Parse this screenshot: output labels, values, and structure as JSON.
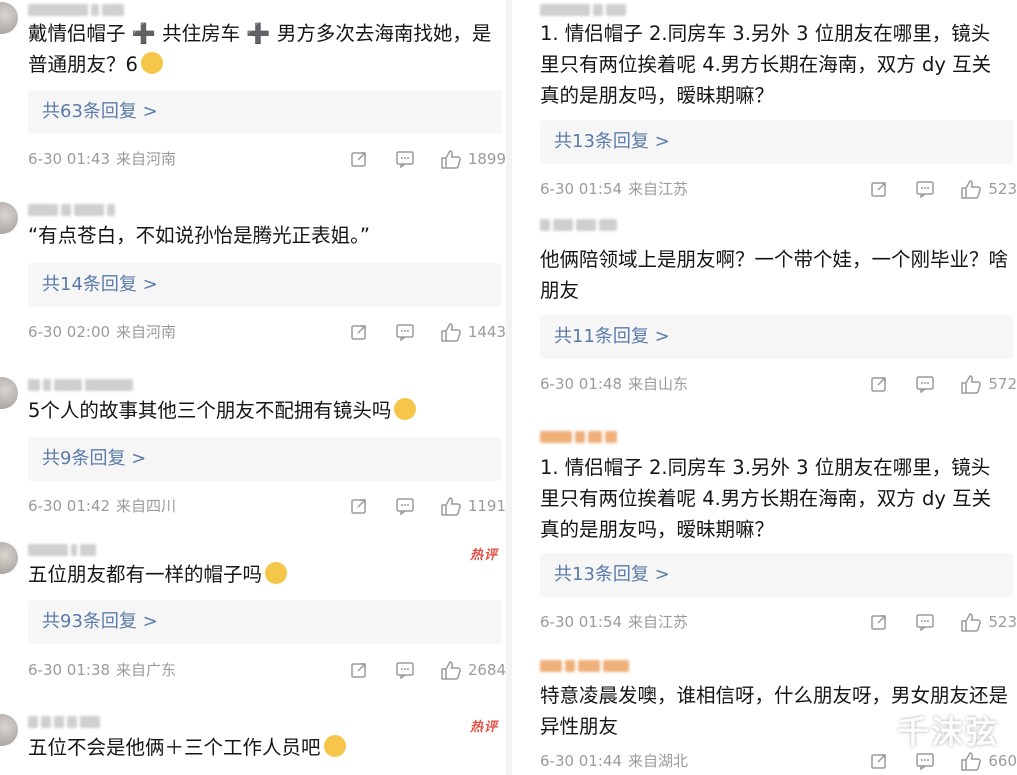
{
  "left": [
    {
      "text": "戴情侣帽子 ➕ 共住房车 ➕ 男方多次去海南找她，是普通朋友？6",
      "emoji": "cat-face",
      "reply": "共63条回复 >",
      "date": "6-30 01:43",
      "loc": "来自河南",
      "likes": "1899",
      "hot": ""
    },
    {
      "text": "“有点苍白，不如说孙怡是腾光正表姐。”",
      "emoji": "",
      "reply": "共14条回复 >",
      "date": "6-30 02:00",
      "loc": "来自河南",
      "likes": "1443",
      "hot": ""
    },
    {
      "text": "5个人的故事其他三个朋友不配拥有镜头吗",
      "emoji": "laughing-face",
      "reply": "共9条回复 >",
      "date": "6-30 01:42",
      "loc": "来自四川",
      "likes": "1191",
      "hot": ""
    },
    {
      "text": "五位朋友都有一样的帽子吗",
      "emoji": "shocked-face",
      "reply": "共93条回复 >",
      "date": "6-30 01:38",
      "loc": "来自广东",
      "likes": "2684",
      "hot": "热评"
    },
    {
      "text": "五位不会是他俩＋三个工作人员吧",
      "emoji": "cat-face",
      "reply": "",
      "date": "",
      "loc": "",
      "likes": "",
      "hot": "热评"
    }
  ],
  "right": [
    {
      "text": "1. 情侣帽子  2.同房车 3.另外 3 位朋友在哪里，镜头里只有两位挨着呢 4.男方长期在海南，双方 dy 互关真的是朋友吗，暧昧期嘛？",
      "reply": "共13条回复 >",
      "date": "6-30 01:54",
      "loc": "来自江苏",
      "likes": "523",
      "hot": ""
    },
    {
      "text": "他俩陪领域上是朋友啊？一个带个娃，一个刚毕业？啥朋友",
      "reply": "共11条回复 >",
      "date": "6-30 01:48",
      "loc": "来自山东",
      "likes": "572",
      "hot": ""
    },
    {
      "text": "1. 情侣帽子  2.同房车 3.另外 3 位朋友在哪里，镜头里只有两位挨着呢 4.男方长期在海南，双方 dy 互关真的是朋友吗，暧昧期嘛？",
      "reply": "共13条回复 >",
      "date": "6-30 01:54",
      "loc": "来自江苏",
      "likes": "523",
      "hot": ""
    },
    {
      "text": "特意凌晨发噢，谁相信呀，什么朋友呀，男女朋友还是异性朋友",
      "reply": "",
      "date": "6-30 01:44",
      "loc": "来自湖北",
      "likes": "660",
      "hot": ""
    }
  ],
  "hot_label": "热评",
  "watermark": "千沫弦",
  "colors": {
    "reply_text": "#5a7ba8",
    "meta": "#9b9b9b",
    "hot": "#e3514a",
    "reply_bg": "#f6f6f6"
  }
}
